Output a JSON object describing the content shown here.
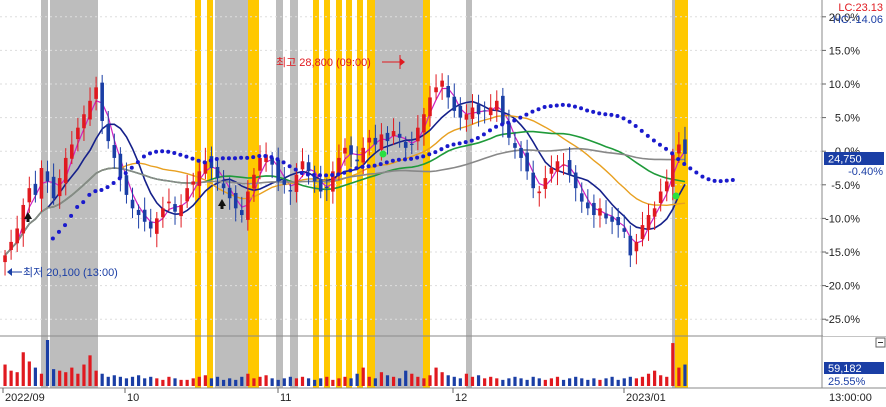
{
  "price_panel": {
    "lc_label": "LC:23.13",
    "hc_label": "HC:-14.06",
    "current_price": "24,750",
    "current_change": "-0.40%",
    "high_marker": "최고 28,800 (09:00)",
    "low_marker": "최저 20,100 (13:00)",
    "y_ticks": [
      "20.0%",
      "15.0%",
      "10.0%",
      "5.0%",
      "0.0%",
      "-5.0%",
      "-10.0%",
      "-15.0%",
      "-20.0%",
      "-25.0%"
    ]
  },
  "volume_panel": {
    "current_volume": "59,182",
    "volume_ratio": "25.55%",
    "collapse_icon": "minus-icon"
  },
  "time_axis": {
    "labels": [
      "2022/09",
      "10",
      "11",
      "12",
      "2023/01"
    ],
    "time_label": "13:00:00"
  },
  "chart_data": {
    "type": "candlestick",
    "x": [
      "2022/09",
      "10",
      "11",
      "12",
      "2023/01"
    ],
    "ylim": [
      -27.5,
      22.5
    ],
    "y_ticks": [
      20,
      15,
      10,
      5,
      0,
      -5,
      -10,
      -15,
      -20,
      -25
    ],
    "close_pct": [
      -15.5,
      -13.5,
      -11.5,
      -8.0,
      -5.5,
      -6.5,
      -2.5,
      -4.5,
      -7.0,
      -4.0,
      -1.0,
      1.0,
      3.5,
      5.5,
      7.5,
      9.5,
      4.5,
      1.5,
      -1.0,
      -4.0,
      -6.5,
      -8.5,
      -9.5,
      -10.5,
      -11.5,
      -10.0,
      -8.5,
      -7.5,
      -9.0,
      -8.0,
      -5.5,
      -4.5,
      -3.0,
      -1.5,
      -2.5,
      -4.0,
      -5.5,
      -7.0,
      -8.5,
      -9.5,
      -6.0,
      -3.5,
      -1.0,
      -0.5,
      -2.0,
      -4.5,
      -5.0,
      -6.0,
      -3.5,
      -1.5,
      -3.0,
      -4.5,
      -6.0,
      -5.5,
      -3.0,
      -1.0,
      0.5,
      -0.5,
      -1.5,
      0.5,
      2.0,
      1.0,
      2.5,
      1.5,
      3.0,
      2.0,
      0.5,
      1.0,
      3.5,
      5.5,
      8.0,
      9.5,
      10.5,
      8.0,
      6.0,
      5.0,
      5.5,
      6.5,
      5.5,
      6.0,
      6.5,
      7.5,
      4.0,
      2.0,
      0.5,
      -1.0,
      -3.0,
      -5.5,
      -6.0,
      -4.0,
      -2.5,
      -1.5,
      -2.0,
      -3.5,
      -5.5,
      -7.5,
      -8.5,
      -9.5,
      -8.5,
      -10.0,
      -10.5,
      -11.0,
      -12.0,
      -15.5,
      -13.5,
      -11.0,
      -9.5,
      -8.5,
      -6.0,
      -4.5,
      -0.5,
      1.0,
      -0.4
    ],
    "volume": [
      14,
      10,
      9,
      22,
      16,
      12,
      8,
      30,
      11,
      10,
      9,
      12,
      8,
      14,
      20,
      10,
      8,
      6,
      7,
      6,
      5,
      6,
      7,
      5,
      6,
      5,
      4,
      6,
      5,
      4,
      4,
      5,
      6,
      7,
      5,
      6,
      4,
      5,
      4,
      6,
      8,
      5,
      6,
      7,
      5,
      4,
      5,
      6,
      5,
      6,
      5,
      4,
      5,
      6,
      4,
      5,
      6,
      5,
      8,
      12,
      6,
      5,
      9,
      7,
      6,
      5,
      10,
      8,
      6,
      5,
      7,
      12,
      9,
      7,
      6,
      5,
      8,
      6,
      7,
      5,
      6,
      5,
      4,
      5,
      6,
      5,
      4,
      6,
      5,
      4,
      5,
      6,
      4,
      5,
      6,
      5,
      4,
      5,
      4,
      5,
      6,
      4,
      5,
      6,
      5,
      6,
      8,
      10,
      7,
      6,
      28,
      12,
      14
    ],
    "series": []
  },
  "colors": {
    "up": "#e0191f",
    "down": "#1a3ea5",
    "highlight_gray": "#bdbdbd",
    "highlight_yellow": "#ffc800",
    "ichimoku_dots": "#1a1acc",
    "ma_pink": "#d020c0",
    "ma_navy": "#15208a",
    "ma_orange": "#e8a020",
    "ma_green": "#1f9a3a",
    "ma_gray": "#888888",
    "current_box": "#1a3ea5"
  }
}
